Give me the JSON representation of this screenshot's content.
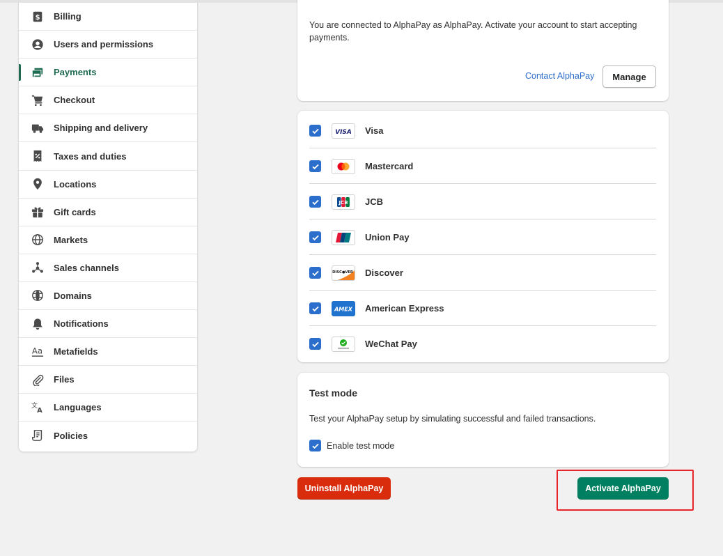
{
  "sidebar": {
    "items": [
      {
        "label": "Billing",
        "icon": "dollar-icon"
      },
      {
        "label": "Users and permissions",
        "icon": "user-icon"
      },
      {
        "label": "Payments",
        "icon": "payment-card-icon",
        "active": true
      },
      {
        "label": "Checkout",
        "icon": "cart-icon"
      },
      {
        "label": "Shipping and delivery",
        "icon": "truck-icon"
      },
      {
        "label": "Taxes and duties",
        "icon": "receipt-percent-icon"
      },
      {
        "label": "Locations",
        "icon": "location-pin-icon"
      },
      {
        "label": "Gift cards",
        "icon": "gift-icon"
      },
      {
        "label": "Markets",
        "icon": "globe-icon"
      },
      {
        "label": "Sales channels",
        "icon": "channels-icon"
      },
      {
        "label": "Domains",
        "icon": "web-globe-icon"
      },
      {
        "label": "Notifications",
        "icon": "bell-icon"
      },
      {
        "label": "Metafields",
        "icon": "text-aa-icon"
      },
      {
        "label": "Files",
        "icon": "paperclip-icon"
      },
      {
        "label": "Languages",
        "icon": "translate-icon"
      },
      {
        "label": "Policies",
        "icon": "document-icon"
      }
    ]
  },
  "connection": {
    "text": "You are connected to AlphaPay as AlphaPay. Activate your account to start accepting payments.",
    "contact_label": "Contact AlphaPay",
    "manage_label": "Manage"
  },
  "methods": [
    {
      "name": "Visa",
      "checked": true,
      "logo": "visa-logo"
    },
    {
      "name": "Mastercard",
      "checked": true,
      "logo": "mastercard-logo"
    },
    {
      "name": "JCB",
      "checked": true,
      "logo": "jcb-logo"
    },
    {
      "name": "Union Pay",
      "checked": true,
      "logo": "unionpay-logo"
    },
    {
      "name": "Discover",
      "checked": true,
      "logo": "discover-logo"
    },
    {
      "name": "American Express",
      "checked": true,
      "logo": "amex-logo"
    },
    {
      "name": "WeChat Pay",
      "checked": true,
      "logo": "wechat-pay-logo"
    }
  ],
  "test_mode": {
    "title": "Test mode",
    "description": "Test your AlphaPay setup by simulating successful and failed transactions.",
    "checkbox_label": "Enable test mode",
    "checked": true
  },
  "actions": {
    "uninstall_label": "Uninstall AlphaPay",
    "activate_label": "Activate AlphaPay"
  },
  "colors": {
    "accent_green": "#008060",
    "danger_red": "#d82c0d",
    "checkbox_blue": "#2c6ecb",
    "highlight_red": "#e8232a"
  }
}
